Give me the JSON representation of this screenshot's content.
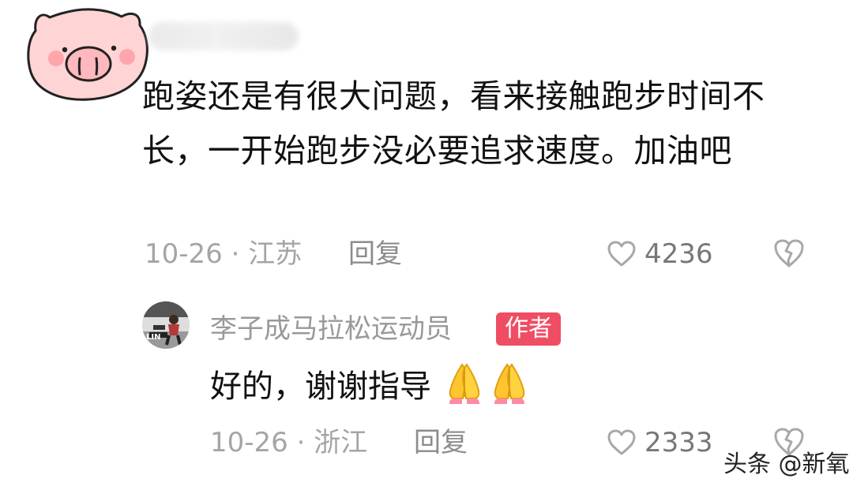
{
  "comment": {
    "text": "跑姿还是有很大问题，看来接触跑步时间不长，一开始跑步没必要追求速度。加油吧",
    "date": "10-26",
    "separator": "·",
    "location": "江苏",
    "reply_label": "回复",
    "likes": "4236",
    "avatar_icon": "pig-avatar-icon",
    "like_icon": "heart-outline-icon",
    "dislike_icon": "broken-heart-icon"
  },
  "reply": {
    "author_name": "李子成马拉松运动员",
    "badge": "作者",
    "text": "好的，谢谢指导",
    "emoji_icon": "folded-hands-icon",
    "date": "10-26",
    "separator": "·",
    "location": "浙江",
    "reply_label": "回复",
    "likes": "2333",
    "like_icon": "heart-outline-icon",
    "dislike_icon": "broken-heart-icon"
  },
  "watermark": "头条 @新氧",
  "colors": {
    "badge": "#EF4D63",
    "meta": "#A5A5A5",
    "text": "#111111"
  }
}
